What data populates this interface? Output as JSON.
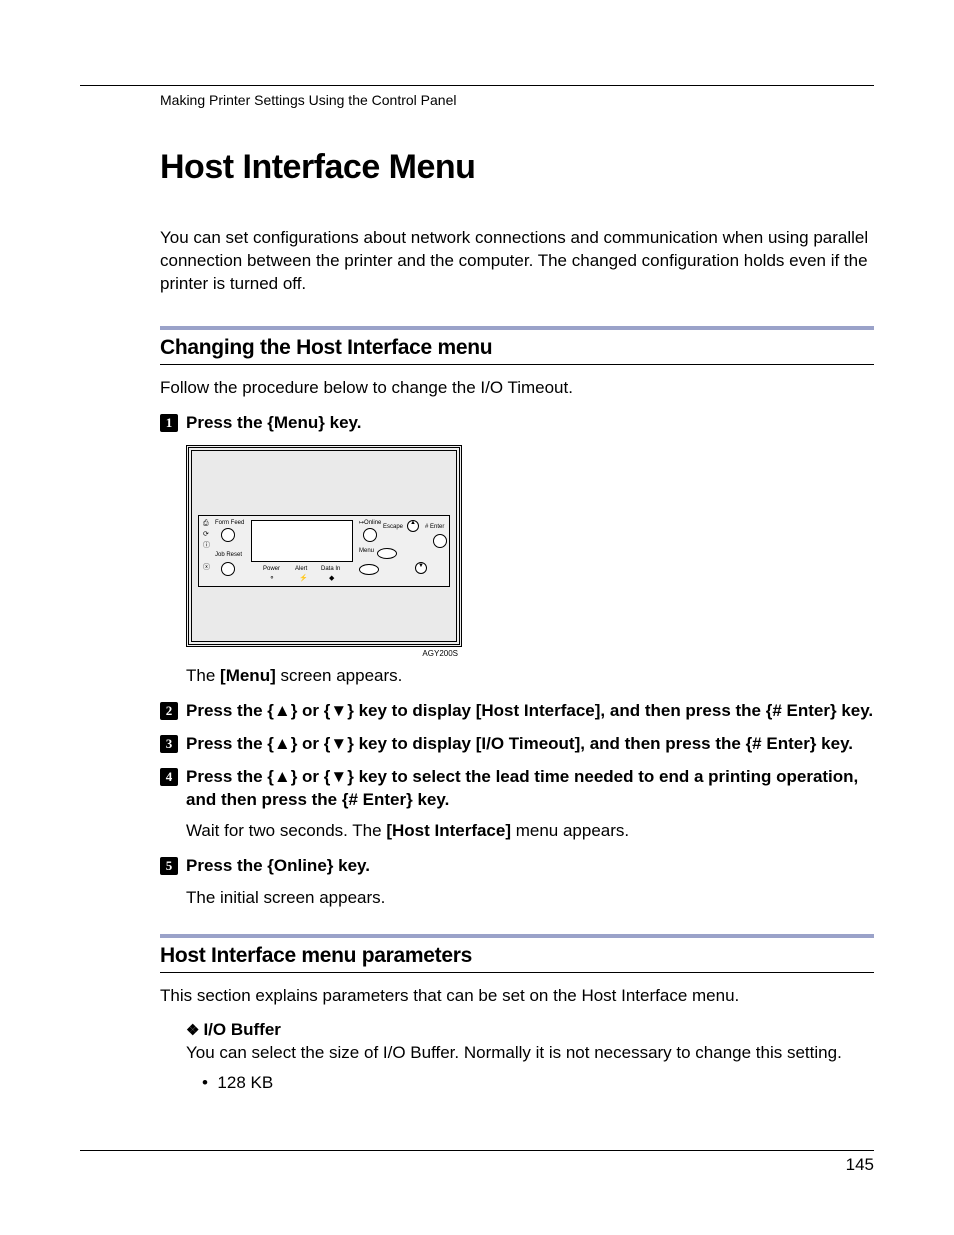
{
  "breadcrumb": "Making Printer Settings Using the Control Panel",
  "title": "Host Interface Menu",
  "intro": "You can set configurations about network connections and communication when using parallel connection between the printer and the computer. The changed configuration holds even if the printer is turned off.",
  "section1": {
    "heading": "Changing the Host Interface menu",
    "lead": "Follow the procedure below to change the I/O Timeout."
  },
  "steps": {
    "s1": {
      "pre": "Press the ",
      "k1": "{Menu}",
      "post": " key.",
      "after_pre": "The ",
      "after_bold": "[Menu]",
      "after_post": " screen appears."
    },
    "s2": {
      "t1": "Press the ",
      "k1": "{▲}",
      "t2": " or ",
      "k2": "{▼}",
      "t3": " key to display ",
      "b1": "[Host Interface]",
      "t4": ", and then press the ",
      "k3": "{# Enter}",
      "t5": " key."
    },
    "s3": {
      "t1": "Press the ",
      "k1": "{▲}",
      "t2": " or ",
      "k2": "{▼}",
      "t3": " key to display ",
      "b1": "[I/O Timeout]",
      "t4": ", and then press the ",
      "k3": "{# Enter}",
      "t5": " key."
    },
    "s4": {
      "t1": "Press the ",
      "k1": "{▲}",
      "t2": " or ",
      "k2": "{▼}",
      "t3": " key to select the lead time needed to end a printing operation, and then press the ",
      "k3": "{# Enter}",
      "t4": " key.",
      "after_pre": "Wait for two seconds. The ",
      "after_bold": "[Host Interface]",
      "after_post": " menu appears."
    },
    "s5": {
      "t1": "Press the ",
      "k1": "{Online}",
      "t2": " key.",
      "after": "The initial screen appears."
    }
  },
  "section2": {
    "heading": "Host Interface menu parameters",
    "lead": "This section explains parameters that can be set on the Host Interface menu.",
    "io_buffer_title": "I/O Buffer",
    "io_buffer_body": "You can select the size of I/O Buffer. Normally it is not necessary to change this setting.",
    "io_buffer_item": "128 KB"
  },
  "panel": {
    "form_feed": "Form Feed",
    "job_reset": "Job Reset",
    "power": "Power",
    "alert": "Alert",
    "data_in": "Data In",
    "online": "Online",
    "menu": "Menu",
    "escape": "Escape",
    "enter": "# Enter",
    "code": "AGY200S"
  },
  "page_number": "145"
}
